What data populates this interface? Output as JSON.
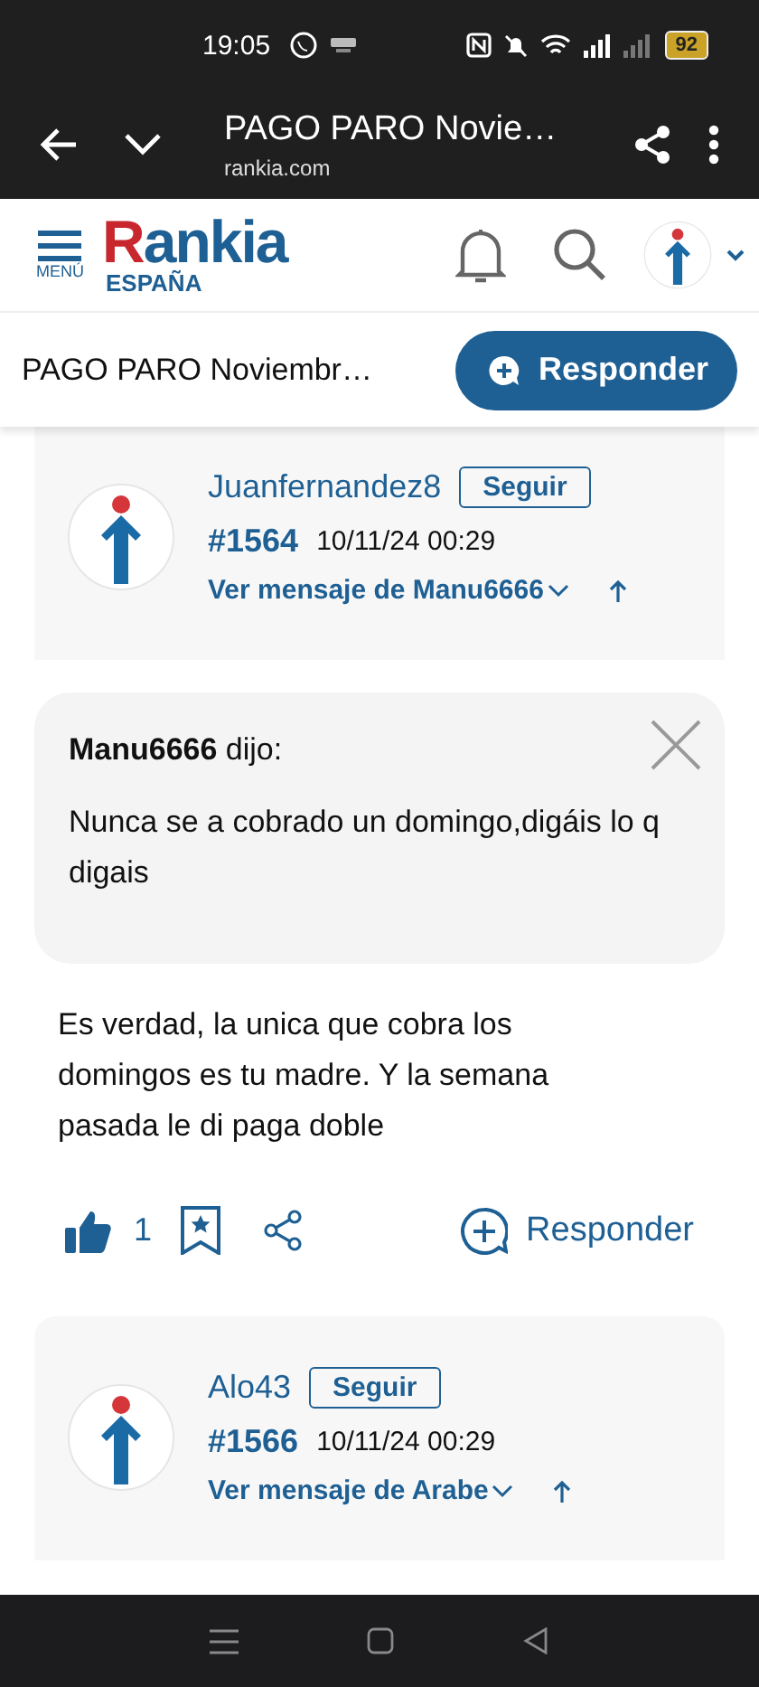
{
  "status_bar": {
    "time": "19:05",
    "battery": "92"
  },
  "browser_bar": {
    "title": "PAGO PARO Novie…",
    "url": "rankia.com"
  },
  "site_header": {
    "menu_label": "MENÚ",
    "logo": "Rankia",
    "region": "ESPAÑA"
  },
  "thread_bar": {
    "title": "PAGO PARO Noviembr…",
    "reply_button": "Responder"
  },
  "posts": [
    {
      "kind": "header",
      "author": "Juanfernandez8",
      "follow": "Seguir",
      "number": "#1564",
      "date": "10/11/24 00:29",
      "reply_to": "Ver mensaje de Manu6666"
    },
    {
      "kind": "quote",
      "author": "Manu6666",
      "said": "dijo:",
      "text": "Nunca se a cobrado un domingo,digáis lo q digais"
    },
    {
      "kind": "body",
      "text": "Es verdad, la unica que cobra los domingos es tu madre. Y la semana pasada le di paga doble"
    },
    {
      "kind": "actions",
      "likes": "1",
      "reply": "Responder"
    },
    {
      "kind": "header",
      "author": "Alo43",
      "follow": "Seguir",
      "number": "#1566",
      "date": "10/11/24 00:29",
      "reply_to": "Ver mensaje de Arabe"
    }
  ]
}
